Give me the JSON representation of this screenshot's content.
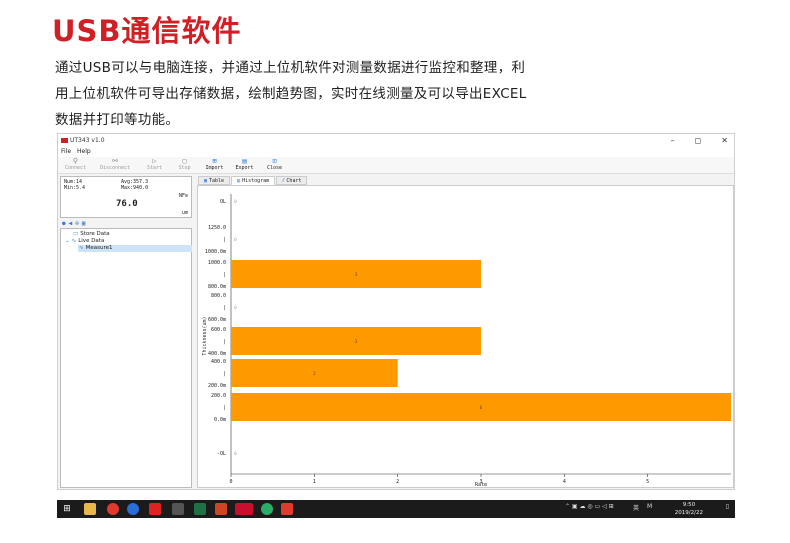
{
  "heading": "USB通信软件",
  "description": {
    "line1": "通过USB可以与电脑连接，并通过上位机软件对测量数据进行监控和整理，利",
    "line2": "用上位机软件可导出存储数据，绘制趋势图，实时在线测量及可以导出EXCEL",
    "line3": "数据并打印等功能。"
  },
  "window": {
    "title": "UT343 v1.0",
    "controls": {
      "minimize": "–",
      "maximize": "◻",
      "close": "✕"
    },
    "menu": [
      "File",
      "Help"
    ],
    "toolbar": [
      {
        "label": "Connect",
        "icon": "link-icon",
        "glyph": "⚲",
        "enabled": false
      },
      {
        "label": "Disconnect",
        "icon": "unlink-icon",
        "glyph": "⚯",
        "enabled": false
      },
      {
        "label": "Start",
        "icon": "play-icon",
        "glyph": "▷",
        "enabled": false
      },
      {
        "label": "Stop",
        "icon": "stop-icon",
        "glyph": "▢",
        "enabled": false
      },
      {
        "label": "Import",
        "icon": "import-icon",
        "glyph": "⊞",
        "enabled": true
      },
      {
        "label": "Export",
        "icon": "export-icon",
        "glyph": "▤",
        "enabled": true
      },
      {
        "label": "Close",
        "icon": "close-doc-icon",
        "glyph": "⊡",
        "enabled": true
      }
    ]
  },
  "reading": {
    "num": "Num:14",
    "avg": "Avg:357.3",
    "min": "Min:5.4",
    "max": "Max:940.0",
    "unit_top": "NFe",
    "value": "76.0",
    "unit_bottom": "um"
  },
  "tree": {
    "store": "Store Data",
    "live": "Live Data",
    "measure": "Measure1"
  },
  "tabs": [
    {
      "label": "Table",
      "icon": "table-icon",
      "active": false
    },
    {
      "label": "Histogram",
      "icon": "histogram-icon",
      "active": true
    },
    {
      "label": "Chart",
      "icon": "chart-icon",
      "active": false
    }
  ],
  "chart_data": {
    "type": "bar",
    "orientation": "horizontal",
    "ylabel": "Thickness(um)",
    "xlabel": "Rate",
    "xlim": [
      0,
      6
    ],
    "x_ticks": [
      "0",
      "1",
      "2",
      "3",
      "4",
      "5"
    ],
    "categories": [
      {
        "labels": [
          "OL"
        ],
        "value": 0
      },
      {
        "labels": [
          "1250.0",
          "|",
          "1000.0m"
        ],
        "value": 0
      },
      {
        "labels": [
          "1000.0",
          "|",
          "800.0m"
        ],
        "value": 3
      },
      {
        "labels": [
          "800.0",
          "|",
          "600.0m"
        ],
        "value": 0
      },
      {
        "labels": [
          "600.0",
          "|",
          "400.0m"
        ],
        "value": 3
      },
      {
        "labels": [
          "400.0",
          "|",
          "200.0m"
        ],
        "value": 2
      },
      {
        "labels": [
          "200.0",
          "|",
          "0.0m"
        ],
        "value": 6
      },
      {
        "labels": [
          "-OL"
        ],
        "value": 0
      }
    ],
    "bar_color": "#ff9900",
    "grid": false,
    "legend": "none"
  },
  "taskbar": {
    "tray_text": "英",
    "tray_m": "M",
    "time": "9:50",
    "date": "2019/2/22"
  }
}
